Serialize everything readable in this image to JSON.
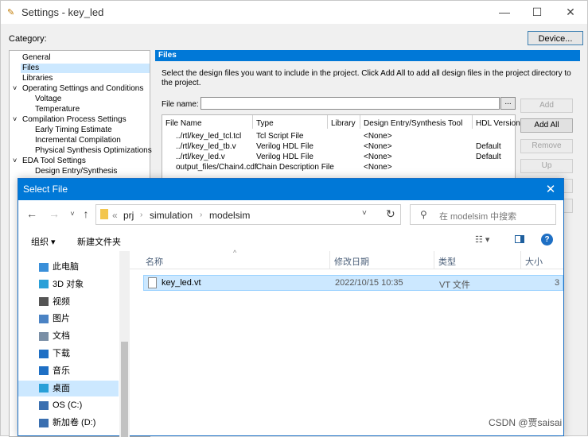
{
  "settings": {
    "title": "Settings - key_led",
    "category_label": "Category:",
    "device_button": "Device...",
    "tree": [
      {
        "label": "General",
        "indent": 0
      },
      {
        "label": "Files",
        "indent": 0
      },
      {
        "label": "Libraries",
        "indent": 0
      },
      {
        "label": "Operating Settings and Conditions",
        "indent": 0,
        "arrow": "˅"
      },
      {
        "label": "Voltage",
        "indent": 1
      },
      {
        "label": "Temperature",
        "indent": 1
      },
      {
        "label": "Compilation Process Settings",
        "indent": 0,
        "arrow": "˅"
      },
      {
        "label": "Early Timing Estimate",
        "indent": 1
      },
      {
        "label": "Incremental Compilation",
        "indent": 1
      },
      {
        "label": "Physical Synthesis Optimizations",
        "indent": 1
      },
      {
        "label": "EDA Tool Settings",
        "indent": 0,
        "arrow": "˅"
      },
      {
        "label": "Design Entry/Synthesis",
        "indent": 1
      }
    ],
    "files_header": "Files",
    "files_desc": "Select the design files you want to include in the project. Click Add All to add all design files in the project directory to the project.",
    "file_name_label": "File name:",
    "browse_label": "...",
    "table_headers": [
      "File Name",
      "Type",
      "Library",
      "Design Entry/Synthesis Tool",
      "HDL Version"
    ],
    "table_rows": [
      [
        "../rtl/key_led_tcl.tcl",
        "Tcl Script File",
        "",
        "<None>",
        ""
      ],
      [
        "../rtl/key_led_tb.v",
        "Verilog HDL File",
        "",
        "<None>",
        "Default"
      ],
      [
        "../rtl/key_led.v",
        "Verilog HDL File",
        "",
        "<None>",
        "Default"
      ],
      [
        "output_files/Chain4.cdf",
        "Chain Description File",
        "",
        "<None>",
        ""
      ]
    ],
    "buttons": {
      "add": "Add",
      "add_all": "Add All",
      "remove": "Remove",
      "up": "Up"
    }
  },
  "dialog": {
    "title": "Select File",
    "breadcrumb": [
      "prj",
      "simulation",
      "modelsim"
    ],
    "search_placeholder": "在 modelsim 中搜索",
    "organize": "组织 ▾",
    "new_folder": "新建文件夹",
    "nav_items": [
      {
        "label": "此电脑",
        "icon": "pc-icon"
      },
      {
        "label": "3D 对象",
        "icon": "cube-icon"
      },
      {
        "label": "视频",
        "icon": "video-icon"
      },
      {
        "label": "图片",
        "icon": "picture-icon"
      },
      {
        "label": "文档",
        "icon": "document-icon"
      },
      {
        "label": "下载",
        "icon": "download-icon"
      },
      {
        "label": "音乐",
        "icon": "music-icon"
      },
      {
        "label": "桌面",
        "icon": "desktop-icon"
      },
      {
        "label": "OS (C:)",
        "icon": "drive-icon"
      },
      {
        "label": "新加卷 (D:)",
        "icon": "drive-icon"
      }
    ],
    "columns": [
      "名称",
      "修改日期",
      "类型",
      "大小"
    ],
    "files": [
      {
        "name": "key_led.vt",
        "date": "2022/10/15 10:35",
        "type": "VT 文件",
        "size": "3"
      }
    ]
  },
  "watermark": "CSDN @贾saisai",
  "colors": {
    "accent": "#0078d7",
    "selection": "#cce8ff"
  }
}
